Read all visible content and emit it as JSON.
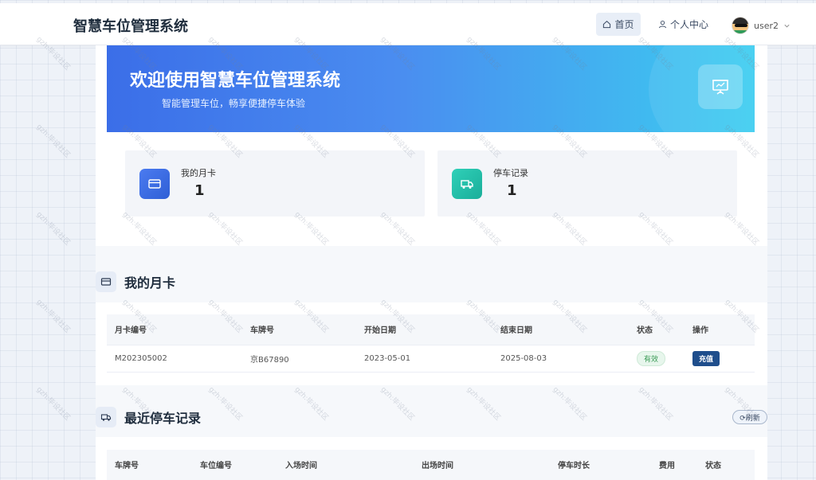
{
  "app": {
    "title": "智慧车位管理系统"
  },
  "nav": {
    "home": "首页",
    "profile": "个人中心",
    "user": "user2"
  },
  "banner": {
    "title": "欢迎使用智慧车位管理系统",
    "subtitle": "智能管理车位，畅享便捷停车体验"
  },
  "stats": [
    {
      "label": "我的月卡",
      "value": "1"
    },
    {
      "label": "停车记录",
      "value": "1"
    }
  ],
  "monthly": {
    "title": "我的月卡",
    "headers": [
      "月卡编号",
      "车牌号",
      "开始日期",
      "结束日期",
      "状态",
      "操作"
    ],
    "row": {
      "id": "M202305002",
      "plate": "京B67890",
      "start": "2023-05-01",
      "end": "2025-08-03",
      "status": "有效",
      "action": "充值"
    }
  },
  "records": {
    "title": "最近停车记录",
    "refresh": "⟳刷新",
    "headers": [
      "车牌号",
      "车位编号",
      "入场时间",
      "出场时间",
      "停车时长",
      "费用",
      "状态"
    ]
  },
  "watermark": "gzh:毕设社区",
  "colors": {
    "primary": "#3b6ee8",
    "banner_end": "#3ccdf0",
    "ok": "#3a9a55",
    "pay": "#1f4e8c"
  }
}
